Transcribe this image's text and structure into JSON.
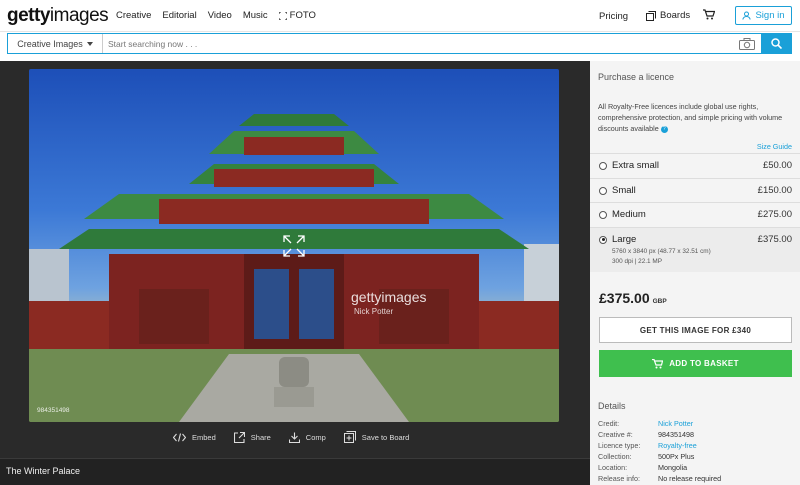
{
  "header": {
    "logo_bold": "getty",
    "logo_light": "images",
    "nav": [
      "Creative",
      "Editorial",
      "Video",
      "Music"
    ],
    "foto_label": "FOTO",
    "pricing": "Pricing",
    "boards": "Boards",
    "signin": "Sign in"
  },
  "search": {
    "type": "Creative Images",
    "placeholder": "Start searching now . . ."
  },
  "image": {
    "watermark_logo": "gettyimages",
    "watermark_credit": "Nick Potter",
    "creative_id": "984351498",
    "caption": "The Winter Palace"
  },
  "actions": [
    {
      "label": "Embed",
      "icon": "embed-icon"
    },
    {
      "label": "Share",
      "icon": "share-icon"
    },
    {
      "label": "Comp",
      "icon": "download-icon"
    },
    {
      "label": "Save to Board",
      "icon": "board-add-icon"
    }
  ],
  "licence": {
    "title": "Purchase a licence",
    "description": "All Royalty-Free licences include global use rights, comprehensive protection, and simple pricing with volume discounts available",
    "size_guide": "Size Guide",
    "sizes": [
      {
        "name": "Extra small",
        "price": "£50.00",
        "selected": false
      },
      {
        "name": "Small",
        "price": "£150.00",
        "selected": false
      },
      {
        "name": "Medium",
        "price": "£275.00",
        "selected": false
      },
      {
        "name": "Large",
        "price": "£375.00",
        "selected": true,
        "dims": "5760 x 3840 px (48.77 x 32.51 cm)",
        "dpi": "300 dpi | 22.1 MP"
      }
    ],
    "total": "£375.00",
    "currency": "GBP",
    "get_button": "GET THIS IMAGE FOR £340",
    "basket_button": "ADD TO BASKET"
  },
  "details": {
    "title": "Details",
    "rows": [
      {
        "key": "Credit:",
        "value": "Nick Potter",
        "link": true
      },
      {
        "key": "Creative #:",
        "value": "984351498",
        "link": false
      },
      {
        "key": "Licence type:",
        "value": "Royalty-free",
        "link": true
      },
      {
        "key": "Collection:",
        "value": "500Px Plus",
        "link": false
      },
      {
        "key": "Location:",
        "value": "Mongolia",
        "link": false
      },
      {
        "key": "Release info:",
        "value": "No release required",
        "link": false
      }
    ]
  },
  "colors": {
    "accent": "#1aa0d8",
    "basket": "#3fbf4e",
    "viewer_bg": "#2a2a2a"
  }
}
